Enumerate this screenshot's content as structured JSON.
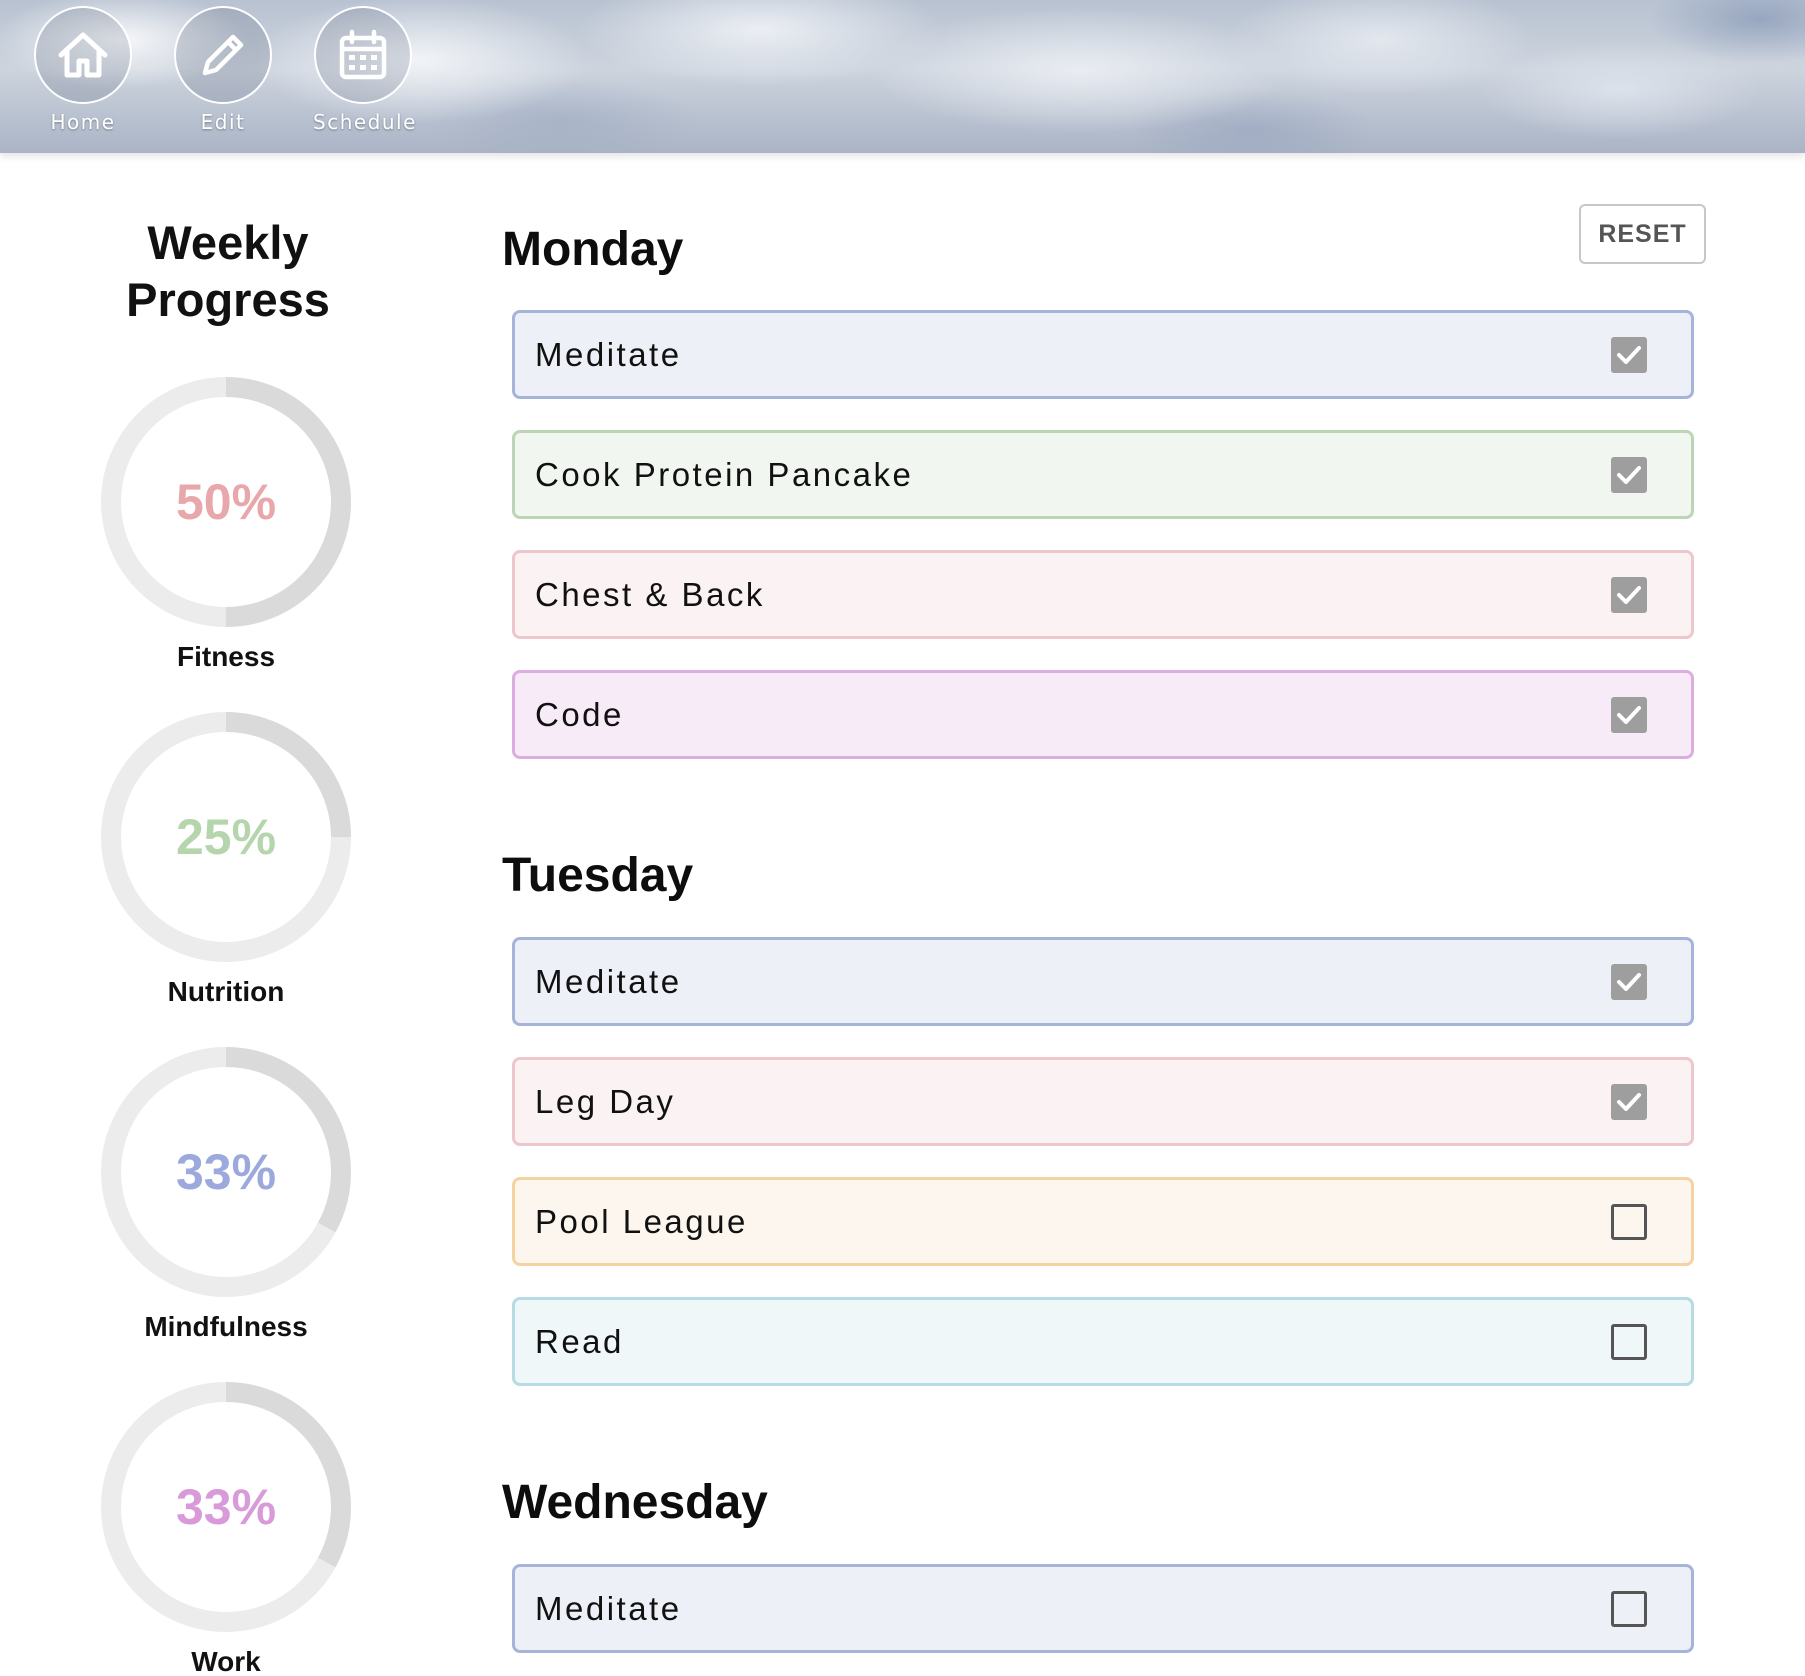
{
  "nav": {
    "items": [
      {
        "id": "home",
        "label": "Home",
        "icon": "home-icon"
      },
      {
        "id": "edit",
        "label": "Edit",
        "icon": "pencil-icon"
      },
      {
        "id": "schedule",
        "label": "Schedule",
        "icon": "calendar-icon"
      }
    ]
  },
  "sidebar": {
    "title_line1": "Weekly",
    "title_line2": "Progress",
    "rings": [
      {
        "label": "Fitness",
        "percent_text": "50%",
        "fraction": 0.5,
        "color": "#e8a7ab"
      },
      {
        "label": "Nutrition",
        "percent_text": "25%",
        "fraction": 0.25,
        "color": "#b5d5ad"
      },
      {
        "label": "Mindfulness",
        "percent_text": "33%",
        "fraction": 0.33,
        "color": "#9ba9dd"
      },
      {
        "label": "Work",
        "percent_text": "33%",
        "fraction": 0.33,
        "color": "#d99ad9"
      }
    ]
  },
  "toolbar": {
    "reset_label": "RESET"
  },
  "days": [
    {
      "name": "Monday",
      "tasks": [
        {
          "label": "Meditate",
          "category": "mind",
          "checked": true
        },
        {
          "label": "Cook Protein Pancake",
          "category": "food",
          "checked": true
        },
        {
          "label": "Chest & Back",
          "category": "fit",
          "checked": true
        },
        {
          "label": "Code",
          "category": "work",
          "checked": true
        }
      ]
    },
    {
      "name": "Tuesday",
      "tasks": [
        {
          "label": "Meditate",
          "category": "mind",
          "checked": true
        },
        {
          "label": "Leg Day",
          "category": "fit",
          "checked": true
        },
        {
          "label": "Pool League",
          "category": "fun",
          "checked": false
        },
        {
          "label": "Read",
          "category": "read",
          "checked": false
        }
      ]
    },
    {
      "name": "Wednesday",
      "tasks": [
        {
          "label": "Meditate",
          "category": "mind",
          "checked": false
        }
      ]
    }
  ],
  "colors": {
    "ring_track": "#ececec",
    "ring_fill": "#dadada",
    "checkbox_checked": "#9e9e9e"
  }
}
